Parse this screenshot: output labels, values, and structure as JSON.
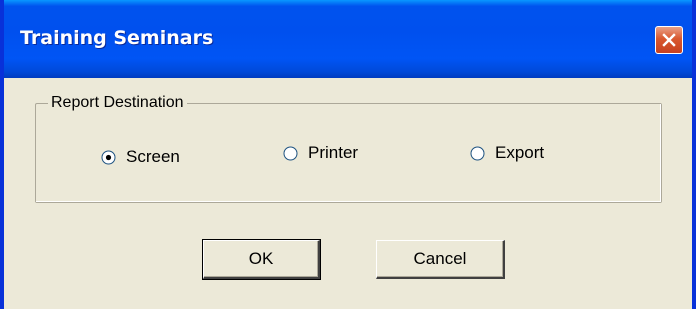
{
  "window": {
    "title": "Training Seminars"
  },
  "report_destination": {
    "label": "Report Destination",
    "options": [
      {
        "label": "Screen",
        "selected": true
      },
      {
        "label": "Printer",
        "selected": false
      },
      {
        "label": "Export",
        "selected": false
      }
    ]
  },
  "buttons": {
    "ok_label": "OK",
    "cancel_label": "Cancel"
  },
  "colors": {
    "titlebar": "#0053ee",
    "face": "#ece9d8",
    "close": "#d9582f"
  },
  "icons": {
    "close": "close-icon"
  }
}
